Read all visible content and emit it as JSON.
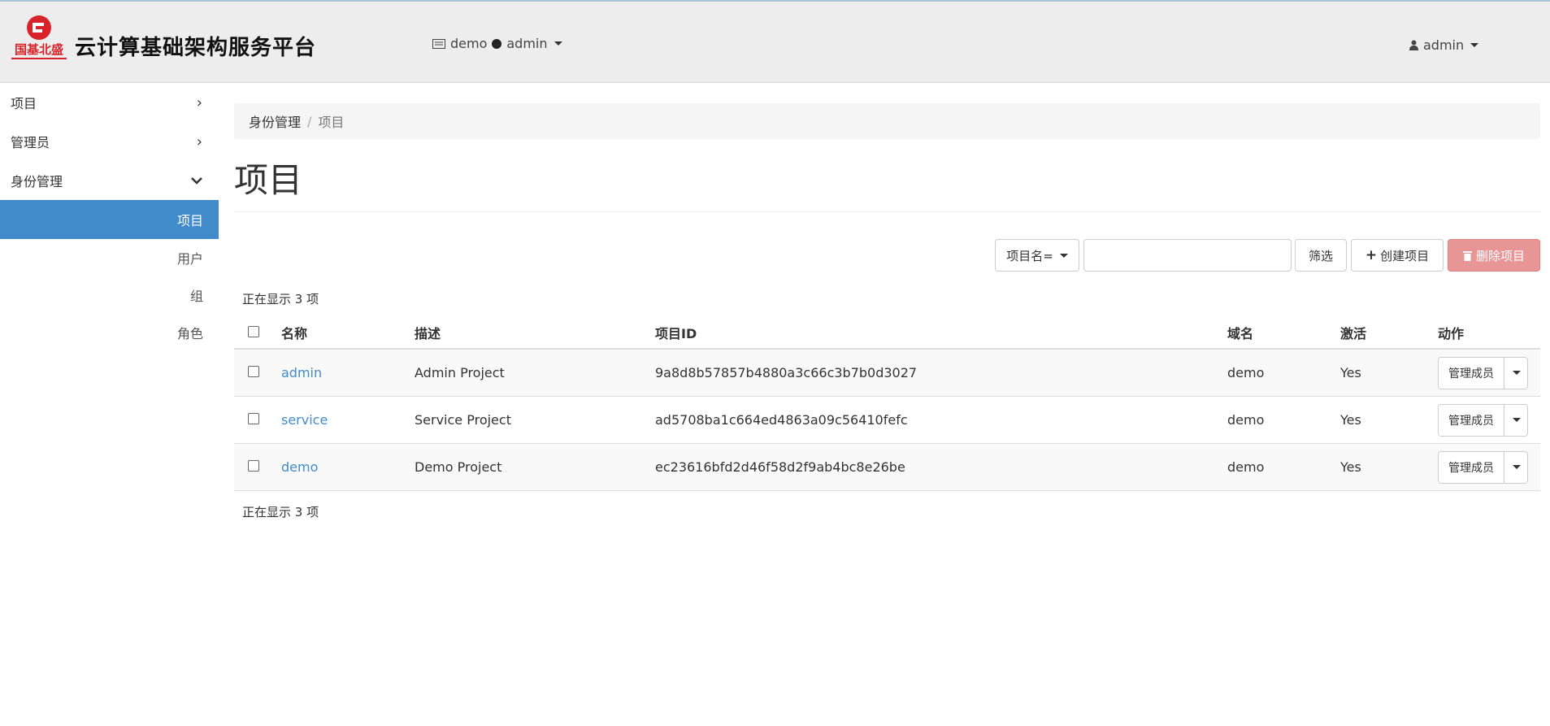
{
  "header": {
    "brand": "云计算基础架构服务平台",
    "logo_text": "国基北盛",
    "context_domain": "demo",
    "context_project": "admin",
    "user": "admin"
  },
  "sidebar": {
    "groups": [
      {
        "label": "项目"
      },
      {
        "label": "管理员"
      },
      {
        "label": "身份管理"
      }
    ],
    "sub_items": [
      {
        "label": "项目"
      },
      {
        "label": "用户"
      },
      {
        "label": "组"
      },
      {
        "label": "角色"
      }
    ]
  },
  "breadcrumb": {
    "root": "身份管理",
    "current": "项目"
  },
  "page_title": "项目",
  "toolbar": {
    "filter_field": "项目名=",
    "filter_value": "",
    "filter_button": "筛选",
    "create_button": "创建项目",
    "delete_button": "删除项目"
  },
  "count_text": "正在显示 3 项",
  "table": {
    "headers": [
      "名称",
      "描述",
      "项目ID",
      "域名",
      "激活",
      "动作"
    ],
    "rows": [
      {
        "name": "admin",
        "desc": "Admin Project",
        "id": "9a8d8b57857b4880a3c66c3b7b0d3027",
        "domain": "demo",
        "enabled": "Yes",
        "action": "管理成员"
      },
      {
        "name": "service",
        "desc": "Service Project",
        "id": "ad5708ba1c664ed4863a09c56410fefc",
        "domain": "demo",
        "enabled": "Yes",
        "action": "管理成员"
      },
      {
        "name": "demo",
        "desc": "Demo Project",
        "id": "ec23616bfd2d46f58d2f9ab4bc8e26be",
        "domain": "demo",
        "enabled": "Yes",
        "action": "管理成员"
      }
    ]
  }
}
